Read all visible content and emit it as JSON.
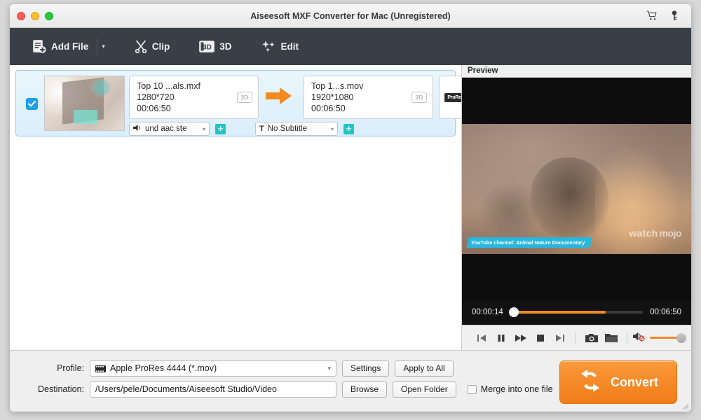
{
  "window": {
    "title": "Aiseesoft MXF Converter for Mac (Unregistered)",
    "cart_icon": "shopping-cart-icon",
    "key_icon": "key-icon",
    "accent_orange": "#f18b21",
    "toolbar_bg": "#3a3f47",
    "selection_blue": "#9fcbe8"
  },
  "toolbar": {
    "add_file": "Add File",
    "add_file_caret": "▾",
    "clip": "Clip",
    "three_d": "3D",
    "edit": "Edit"
  },
  "file_list": {
    "checked": true,
    "source": {
      "name": "Top 10 ...als.mxf",
      "resolution": "1280*720",
      "duration": "00:06:50",
      "dimension_badge": "2D"
    },
    "target": {
      "name": "Top 1...s.mov",
      "resolution": "1920*1080",
      "duration": "00:06:50",
      "dimension_badge": "2D",
      "codec_badge": "ProRes"
    },
    "audio_track": "und aac ste",
    "subtitle_track": "No Subtitle",
    "add_audio_label": "+",
    "add_subtitle_label": "+",
    "close_label": "×"
  },
  "preview": {
    "header": "Preview",
    "overlay_banner": "YouTube channel: Animal Nature Documentary",
    "watermark_1": "watch",
    "watermark_2": "mojo",
    "current_time": "00:00:14",
    "total_time": "00:06:50",
    "progress_percent": 72,
    "volume_percent": 100,
    "controls": [
      {
        "name": "previous-button",
        "glyph": "previous"
      },
      {
        "name": "pause-button",
        "glyph": "pause"
      },
      {
        "name": "fast-forward-button",
        "glyph": "forward"
      },
      {
        "name": "stop-button",
        "glyph": "stop"
      },
      {
        "name": "next-button",
        "glyph": "next"
      },
      {
        "name": "snapshot-button",
        "glyph": "camera"
      },
      {
        "name": "open-snapshot-folder-button",
        "glyph": "folder"
      }
    ],
    "volume_icon": "speaker-mute-icon"
  },
  "bottom": {
    "profile_label": "Profile:",
    "profile_value": "Apple ProRes 4444 (*.mov)",
    "destination_label": "Destination:",
    "destination_value": "/Users/pele/Documents/Aiseesoft Studio/Video",
    "settings_button": "Settings",
    "apply_to_all_button": "Apply to All",
    "browse_button": "Browse",
    "open_folder_button": "Open Folder",
    "merge_label": "Merge into one file",
    "merge_checked": false,
    "convert_button": "Convert"
  }
}
